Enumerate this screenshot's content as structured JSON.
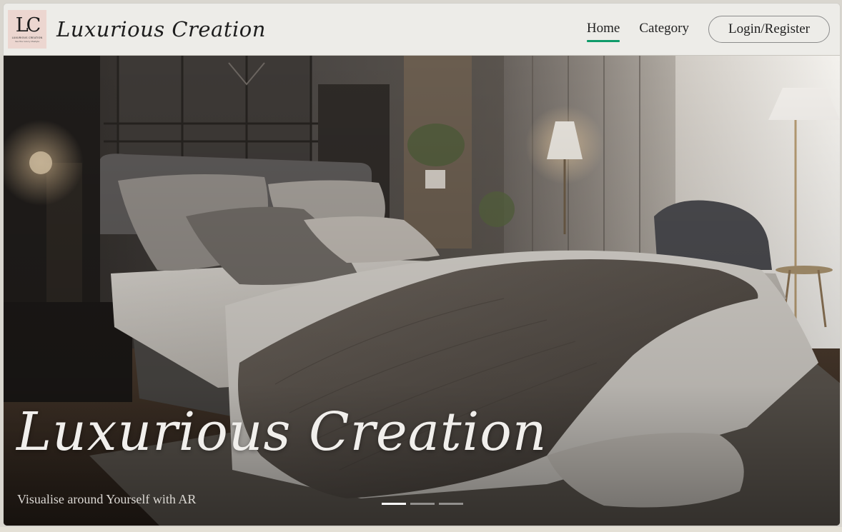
{
  "brand": {
    "logo_mark": "LC",
    "logo_tagline": "LUXURIOUS CREATION",
    "logo_subtagline": "live the luxury lifestyle",
    "name": "Luxurious Creation"
  },
  "nav": {
    "items": [
      {
        "label": "Home",
        "active": true
      },
      {
        "label": "Category",
        "active": false
      }
    ],
    "login_label": "Login/Register",
    "accent_color": "#0f9b6a"
  },
  "hero": {
    "title": "Luxurious Creation",
    "subtitle": "Visualise around Yourself with AR",
    "image": "bedroom-scene",
    "slides": [
      {
        "active": true
      },
      {
        "active": false
      },
      {
        "active": false
      }
    ]
  }
}
